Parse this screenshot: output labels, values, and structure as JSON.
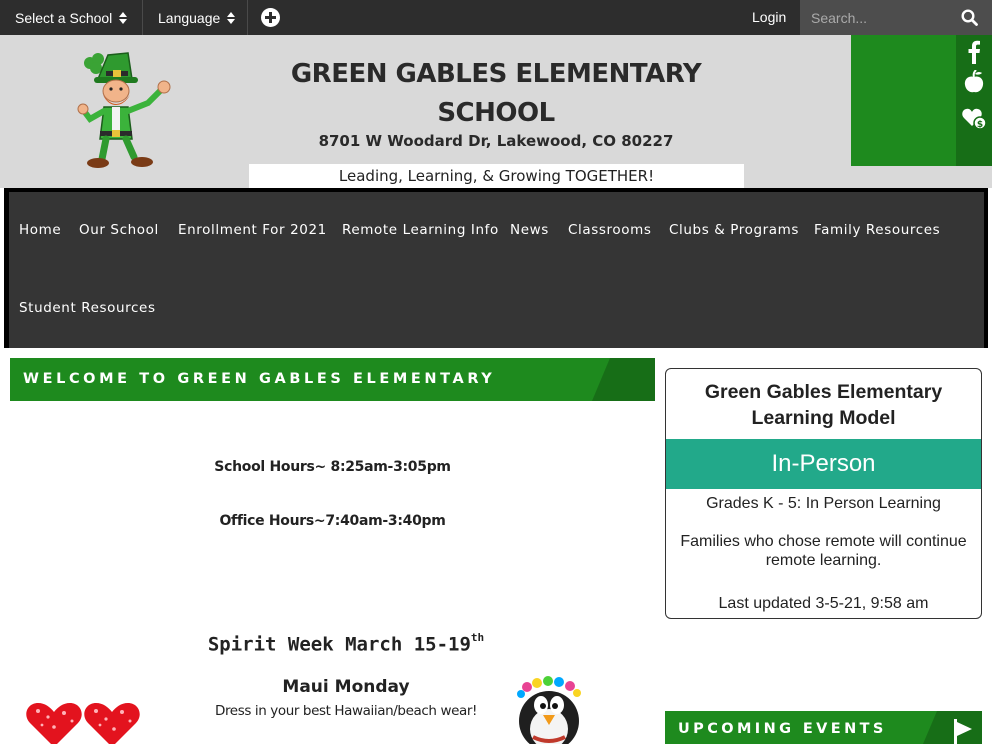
{
  "topbar": {
    "select_school": "Select a School",
    "language": "Language",
    "login": "Login",
    "search_placeholder": "Search..."
  },
  "header": {
    "school_name": "GREEN GABLES ELEMENTARY SCHOOL",
    "address": "8701 W Woodard Dr, Lakewood, CO 80227",
    "tagline": "Leading, Learning, & Growing TOGETHER!",
    "social_icons": [
      "facebook-icon",
      "peachjar-icon",
      "donate-heart-icon"
    ]
  },
  "nav": {
    "items": [
      "Home",
      "Our School",
      "Enrollment For 2021",
      "Remote Learning Info",
      "News",
      "Classrooms",
      "Clubs & Programs",
      "Family Resources",
      "Student Resources"
    ]
  },
  "welcome": {
    "title": "WELCOME TO GREEN GABLES ELEMENTARY",
    "school_hours": "School Hours~ 8:25am-3:05pm",
    "office_hours": "Office Hours~7:40am-3:40pm",
    "spirit_week": "Spirit Week March 15-19",
    "spirit_week_sup": "th",
    "maui_monday": "Maui Monday",
    "dress": "Dress in your best Hawaiian/beach wear!"
  },
  "learning_model": {
    "title": "Green Gables Elementary Learning Model",
    "status": "In-Person",
    "grades": "Grades K - 5: In Person Learning",
    "remote_note": "Families who chose remote will continue remote learning.",
    "updated": "Last updated 3-5-21, 9:58 am"
  },
  "events": {
    "title": "UPCOMING EVENTS"
  },
  "colors": {
    "green": "#1e8a1e",
    "dark_green": "#176e17",
    "teal": "#22a98a",
    "topbar": "#2d2d2d",
    "nav": "#353535"
  }
}
